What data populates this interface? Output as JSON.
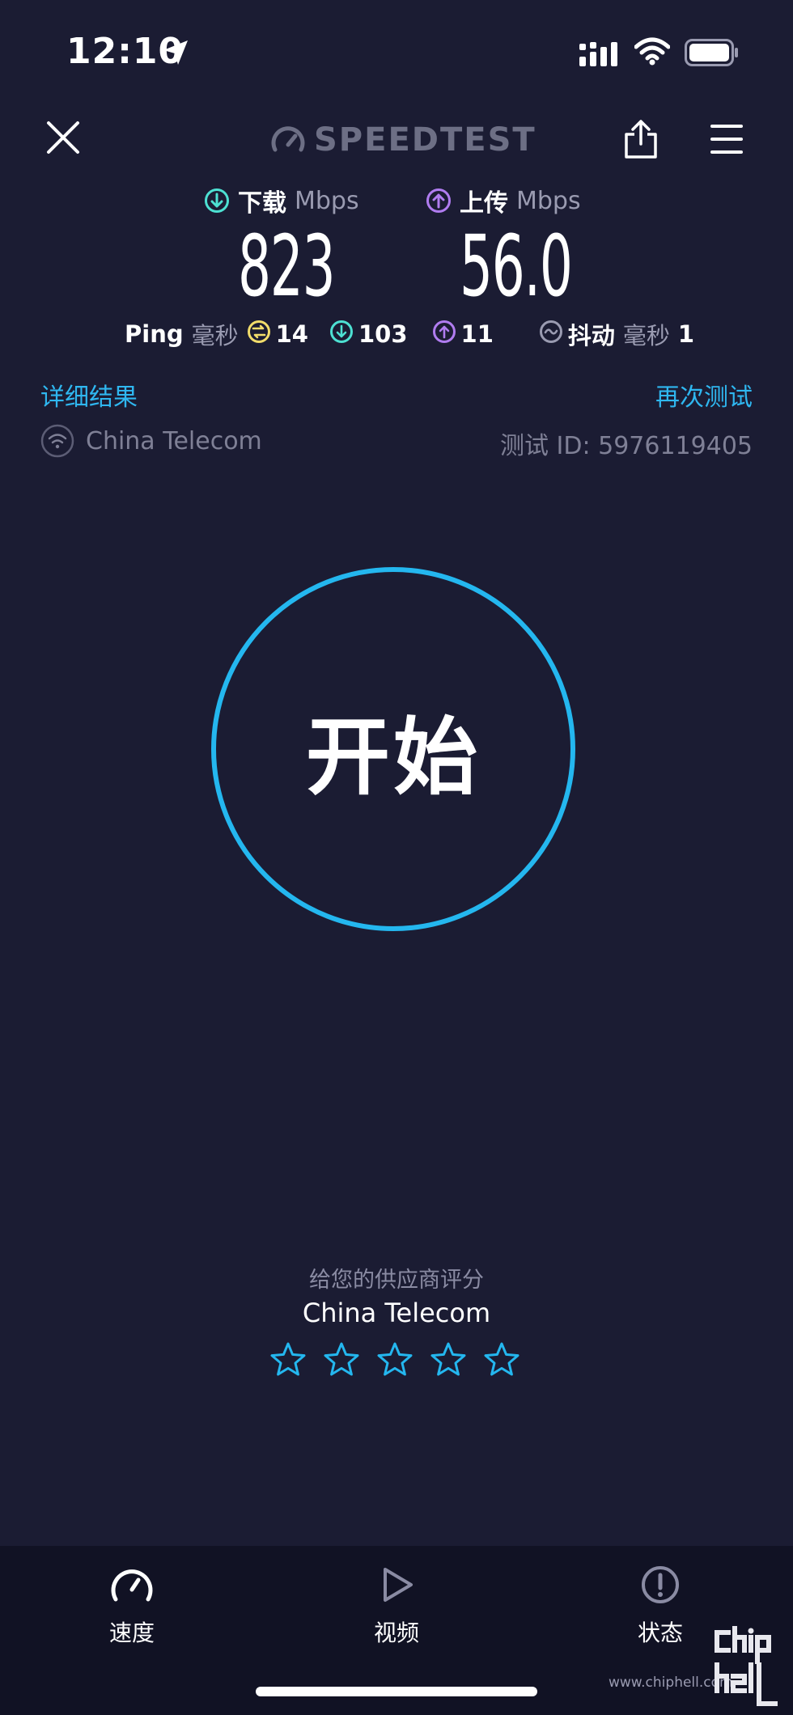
{
  "status_bar": {
    "time": "12:10"
  },
  "header": {
    "logo_text": "SPEEDTEST"
  },
  "download": {
    "label": "下载",
    "unit": "Mbps",
    "value": "823"
  },
  "upload": {
    "label": "上传",
    "unit": "Mbps",
    "value": "56.0"
  },
  "ping": {
    "label": "Ping",
    "unit": "毫秒",
    "idle": "14",
    "download": "103",
    "upload": "11",
    "jitter_label": "抖动",
    "jitter_unit": "毫秒",
    "jitter": "1"
  },
  "links": {
    "details": "详细结果",
    "retest": "再次测试"
  },
  "connection": {
    "isp": "China Telecom",
    "test_id": "测试 ID: 5976119405"
  },
  "start_button": {
    "label": "开始"
  },
  "rating": {
    "prompt": "给您的供应商评分",
    "isp": "China Telecom",
    "stars_total": 5,
    "stars_selected": 0
  },
  "bottom_nav": [
    {
      "label": "速度",
      "icon": "gauge-icon"
    },
    {
      "label": "视频",
      "icon": "play-icon"
    },
    {
      "label": "状态",
      "icon": "alert-icon"
    }
  ],
  "watermark": {
    "url": "www.chiphell.com",
    "logo": "chip hell"
  },
  "colors": {
    "background": "#1b1c33",
    "accent": "#24b7ef",
    "download": "#4de0d2",
    "upload": "#b07cf0",
    "idle": "#f2dd6b",
    "nav_bg": "#111224"
  }
}
